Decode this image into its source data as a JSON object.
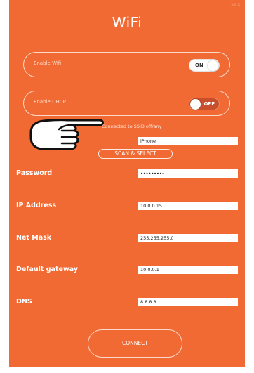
{
  "header": {
    "title": "WiFi",
    "corner_mark": "xxx"
  },
  "wifi": {
    "label": "Enable Wifi",
    "toggle": "ON"
  },
  "dhcp": {
    "label": "Enable DHCP",
    "toggle": "OFF"
  },
  "status": "Connected to SSID off/any",
  "ssid": {
    "value": "iPhone"
  },
  "scan": {
    "label": "SCAN & SELECT"
  },
  "fields": {
    "password": {
      "label": "Password",
      "value": "•••••••••"
    },
    "ip": {
      "label": "IP Address",
      "value": "10.0.0.15"
    },
    "mask": {
      "label": "Net Mask",
      "value": "255.255.255.0"
    },
    "gateway": {
      "label": "Default gateway",
      "value": "10.0.0.1"
    },
    "dns": {
      "label": "DNS",
      "value": "8.8.8.8"
    }
  },
  "connect": {
    "label": "CONNECT"
  },
  "colors": {
    "panel": "#f26a33",
    "text": "#ffffff"
  },
  "icons": {
    "pointer": "pointing-hand-icon"
  }
}
